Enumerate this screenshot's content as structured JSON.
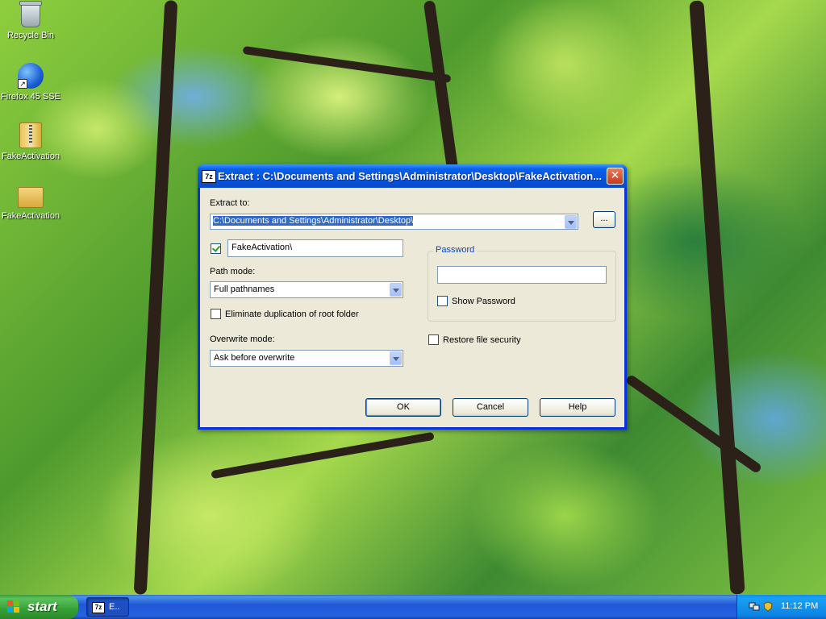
{
  "desktop": {
    "icons": [
      {
        "label": "Recycle Bin",
        "icon": "recycle-bin-icon"
      },
      {
        "label": "Firefox 45 SSE",
        "icon": "firefox-icon"
      },
      {
        "label": "FakeActivation",
        "icon": "zip-archive-icon"
      },
      {
        "label": "FakeActivation",
        "icon": "folder-icon"
      }
    ]
  },
  "dialog": {
    "app_icon": "7z",
    "title": "Extract : C:\\Documents and Settings\\Administrator\\Desktop\\FakeActivation...",
    "close_glyph": "✕",
    "extract_to_label": "Extract to:",
    "extract_to_value": "C:\\Documents and Settings\\Administrator\\Desktop\\",
    "browse_label": "...",
    "subfolder_checked": true,
    "subfolder_value": "FakeActivation\\",
    "path_mode_label": "Path mode:",
    "path_mode_value": "Full pathnames",
    "eliminate_label": "Eliminate duplication of root folder",
    "eliminate_checked": false,
    "overwrite_label": "Overwrite mode:",
    "overwrite_value": "Ask before overwrite",
    "password_group": "Password",
    "password_value": "",
    "show_password_label": "Show Password",
    "show_password_checked": false,
    "restore_security_label": "Restore file security",
    "restore_security_checked": false,
    "ok_label": "OK",
    "cancel_label": "Cancel",
    "help_label": "Help"
  },
  "taskbar": {
    "start_label": "start",
    "task_icon": "7z",
    "task_label": "E..",
    "clock": "11:12 PM"
  }
}
